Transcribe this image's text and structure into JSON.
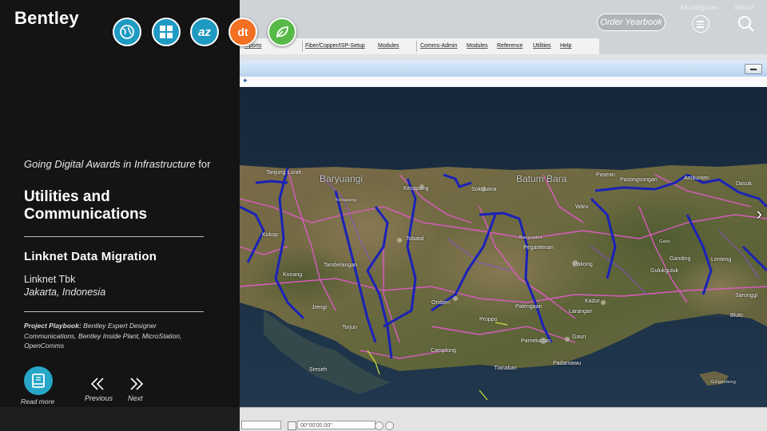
{
  "brand": {
    "logo_text": "Bentley"
  },
  "category_icons": [
    {
      "name": "globe-icon",
      "color": "#1f9ac2"
    },
    {
      "name": "grid-icon",
      "color": "#1f9ac2"
    },
    {
      "name": "az-icon",
      "color": "#1f9ac2"
    },
    {
      "name": "dt-icon",
      "color": "#f36f21"
    },
    {
      "name": "leaf-icon",
      "color": "#57b947"
    }
  ],
  "header": {
    "order_yearbook_label": "Order Yearbook",
    "all_categories_label": "All categories",
    "search_label": "Search"
  },
  "award": {
    "line_part1": "Going Digital Awards in Infrastructure",
    "line_for": " for",
    "category_title": "Utilities and Communications"
  },
  "project": {
    "title": "Linknet Data Migration",
    "organization": "Linknet Tbk",
    "location": "Jakarta, Indonesia",
    "playbook_label": "Project Playbook:",
    "playbook_text": " Bentley Expert Designer Communications, Bentley Inside Plant, MicroStation, OpenComms"
  },
  "nav": {
    "read_more_label": "Read more",
    "previous_label": "Previous",
    "next_label": "Next"
  },
  "app_menu": {
    "items": [
      "...ports",
      "Fiber/Copper/ISP-Setup",
      "Modules",
      "Comms-Admin",
      "Modules",
      "Reference",
      "Utilities",
      "Help"
    ]
  },
  "status": {
    "angle_field": "00°00'00.00\""
  },
  "map": {
    "place_labels": [
      "Baryuangi",
      "Batum Bara",
      "Tanjung Lurah",
      "Kecapang",
      "Sokobana",
      "Pasean",
      "Pasongsongan",
      "Ambunten",
      "Dasuk",
      "Waru",
      "Kokop",
      "Tobatal",
      "Konang",
      "Tambelangan",
      "Sreseh",
      "Camplong",
      "Tlanakan",
      "Padamawu",
      "Palengaan",
      "Pegantenan",
      "Pakong",
      "Kadur",
      "Larangan",
      "Gaun",
      "Proppo",
      "Pamekasan",
      "Omben",
      "Jrengi",
      "Torjun",
      "Bluto",
      "Saronggi",
      "Lenteng",
      "Ganding",
      "Gulukguluk",
      "Giligenteng",
      "Ketapang",
      "Banyuates",
      "Galis"
    ],
    "colors": {
      "blue_line": "#1a22b8",
      "pink_line": "#e85ad0",
      "purple_line": "#8a4fd1"
    }
  }
}
